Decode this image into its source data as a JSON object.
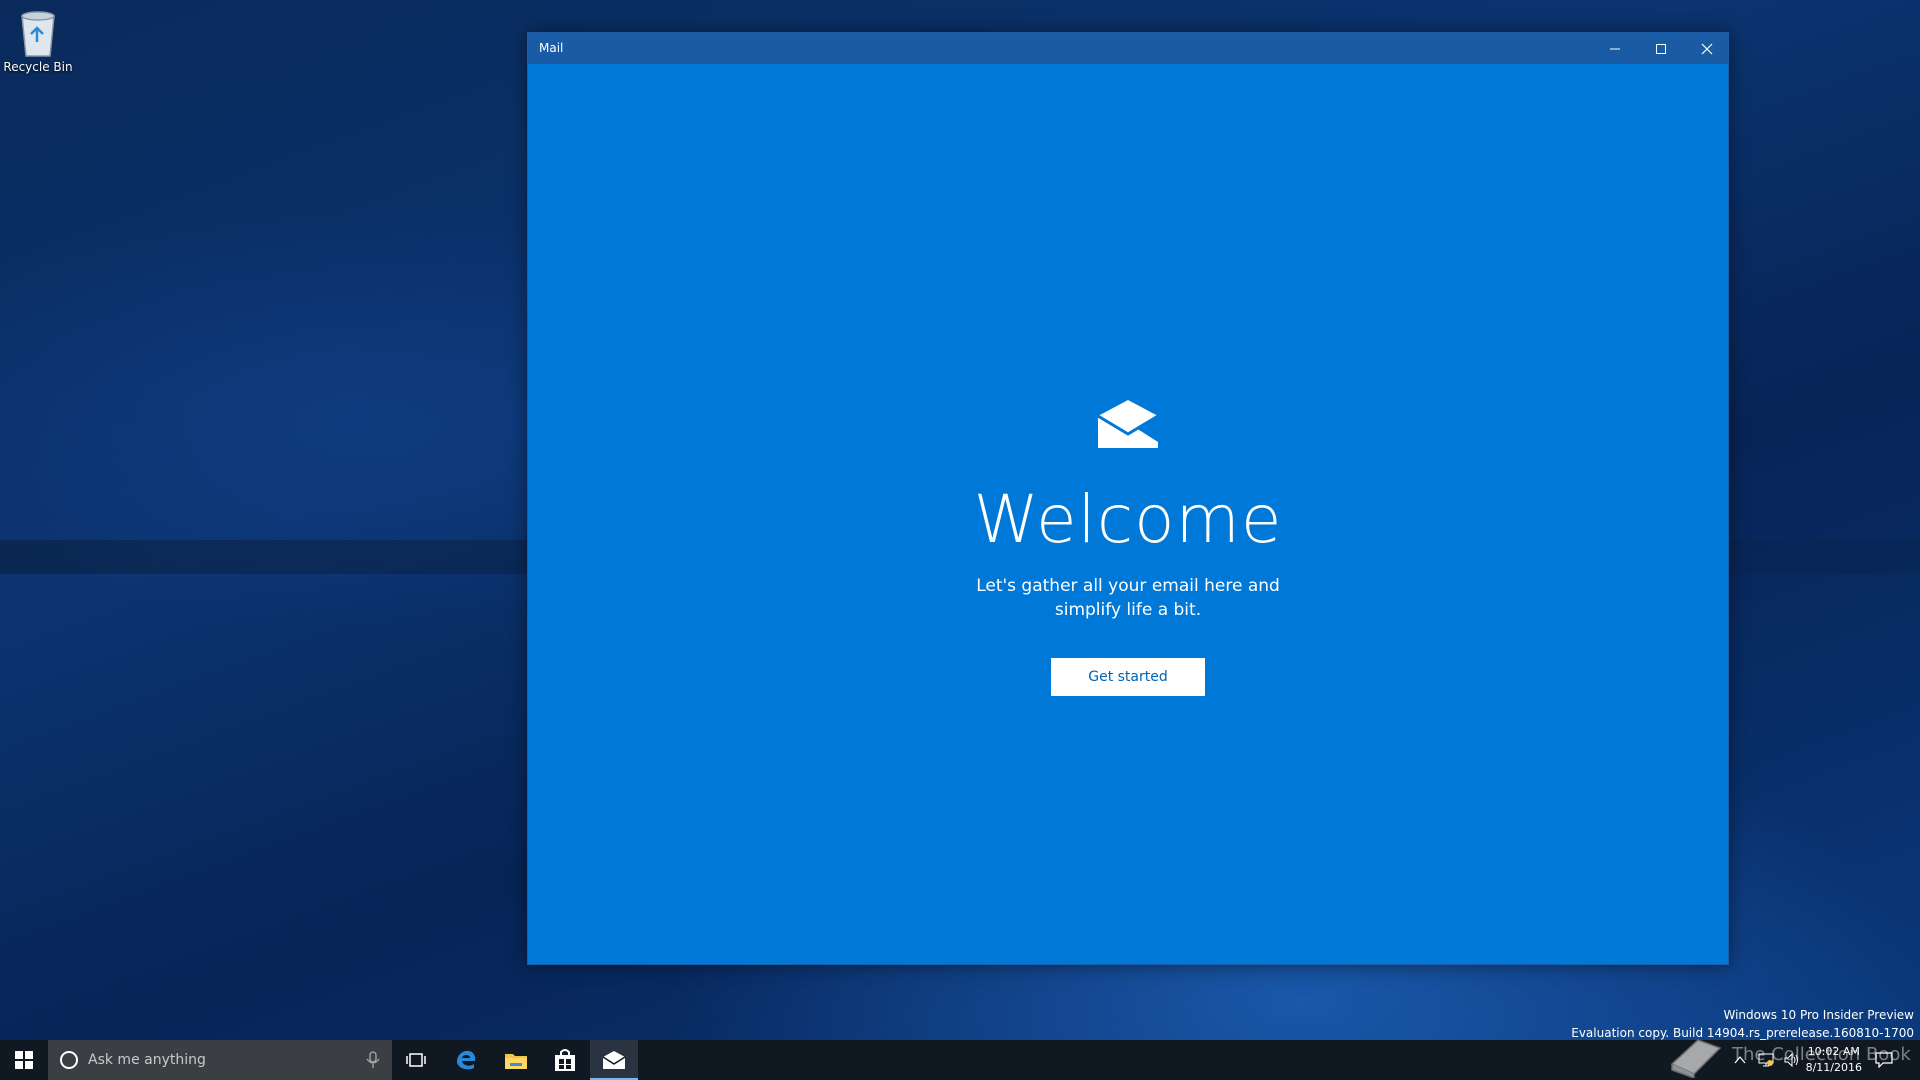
{
  "desktop": {
    "recycle_bin_label": "Recycle Bin"
  },
  "window": {
    "title": "Mail",
    "controls": {
      "minimize": "minimize-icon",
      "maximize": "maximize-icon",
      "close": "close-icon"
    }
  },
  "welcome": {
    "heading": "Welcome",
    "subtitle": "Let's gather all your email here and simplify life a bit.",
    "button_label": "Get started"
  },
  "taskbar": {
    "search_placeholder": "Ask me anything",
    "pinned": [
      "task-view-icon",
      "edge-icon",
      "file-explorer-icon",
      "store-icon",
      "mail-icon"
    ]
  },
  "tray": {
    "time": "10:02 AM",
    "date": "8/11/2016"
  },
  "watermark": {
    "line1": "Windows 10 Pro Insider Preview",
    "line2": "Evaluation copy. Build 14904.rs_prerelease.160810-1700"
  },
  "branding": {
    "text": "The Collection Book"
  },
  "colors": {
    "app_accent": "#0078d7",
    "titlebar": "#195ba4",
    "taskbar": "#101922",
    "button_text": "#0063b1"
  }
}
